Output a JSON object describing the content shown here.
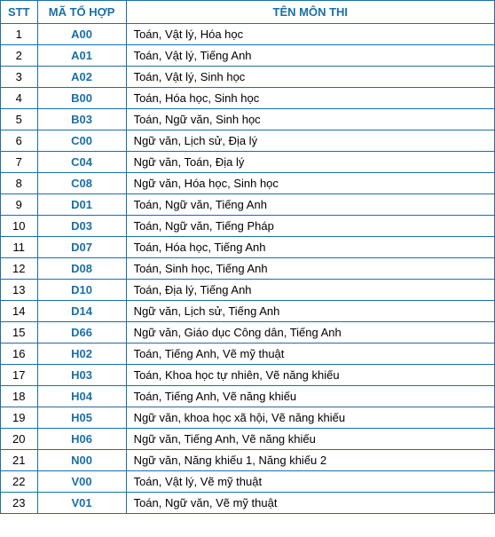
{
  "table": {
    "headers": {
      "stt": "STT",
      "ma": "MÃ TỔ HỢP",
      "ten": "TÊN MÔN THI"
    },
    "rows": [
      {
        "stt": "1",
        "ma": "A00",
        "ten": "Toán, Vật lý, Hóa học"
      },
      {
        "stt": "2",
        "ma": "A01",
        "ten": "Toán, Vật lý, Tiếng Anh"
      },
      {
        "stt": "3",
        "ma": "A02",
        "ten": "Toán, Vật lý, Sinh học"
      },
      {
        "stt": "4",
        "ma": "B00",
        "ten": "Toán, Hóa học, Sinh học"
      },
      {
        "stt": "5",
        "ma": "B03",
        "ten": "Toán, Ngữ văn, Sinh học"
      },
      {
        "stt": "6",
        "ma": "C00",
        "ten": "Ngữ văn, Lịch sử, Địa lý"
      },
      {
        "stt": "7",
        "ma": "C04",
        "ten": "Ngữ văn, Toán, Địa lý"
      },
      {
        "stt": "8",
        "ma": "C08",
        "ten": "Ngữ văn, Hóa học, Sinh học"
      },
      {
        "stt": "9",
        "ma": "D01",
        "ten": "Toán, Ngữ văn, Tiếng Anh"
      },
      {
        "stt": "10",
        "ma": "D03",
        "ten": "Toán, Ngữ văn, Tiếng Pháp"
      },
      {
        "stt": "11",
        "ma": "D07",
        "ten": "Toán, Hóa học, Tiếng Anh"
      },
      {
        "stt": "12",
        "ma": "D08",
        "ten": "Toán, Sinh học, Tiếng Anh"
      },
      {
        "stt": "13",
        "ma": "D10",
        "ten": "Toán, Địa lý, Tiếng Anh"
      },
      {
        "stt": "14",
        "ma": "D14",
        "ten": "Ngữ văn, Lịch sử, Tiếng Anh"
      },
      {
        "stt": "15",
        "ma": "D66",
        "ten": "Ngữ văn, Giáo dục Công dân, Tiếng Anh"
      },
      {
        "stt": "16",
        "ma": "H02",
        "ten": "Toán, Tiếng Anh, Vẽ mỹ thuật"
      },
      {
        "stt": "17",
        "ma": "H03",
        "ten": "Toán, Khoa học tự nhiên, Vẽ năng khiếu"
      },
      {
        "stt": "18",
        "ma": "H04",
        "ten": "Toán, Tiếng Anh, Vẽ năng khiếu"
      },
      {
        "stt": "19",
        "ma": "H05",
        "ten": "Ngữ văn, khoa học xã hội, Vẽ năng khiếu"
      },
      {
        "stt": "20",
        "ma": "H06",
        "ten": "Ngữ văn, Tiếng Anh, Vẽ năng khiếu"
      },
      {
        "stt": "21",
        "ma": "N00",
        "ten": "Ngữ văn, Năng khiếu 1, Năng khiếu 2"
      },
      {
        "stt": "22",
        "ma": "V00",
        "ten": "Toán, Vật lý, Vẽ mỹ thuật"
      },
      {
        "stt": "23",
        "ma": "V01",
        "ten": "Toán, Ngữ văn, Vẽ mỹ thuật"
      }
    ]
  }
}
